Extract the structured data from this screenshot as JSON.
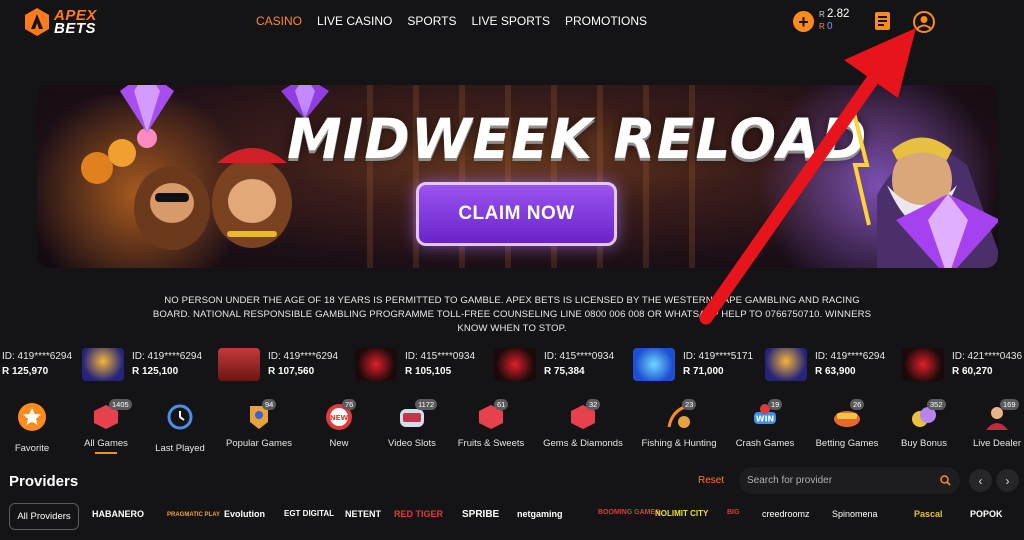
{
  "brand": {
    "line1": "APEX",
    "line2": "BETS"
  },
  "nav": [
    "CASINO",
    "LIVE CASINO",
    "SPORTS",
    "LIVE SPORTS",
    "PROMOTIONS"
  ],
  "balance": {
    "currency": "R",
    "main": "2.82",
    "bonus": "0"
  },
  "banner": {
    "headline": "MIDWEEK RELOAD",
    "cta": "CLAIM NOW"
  },
  "disclaimer": "NO PERSON UNDER THE AGE OF 18 YEARS IS PERMITTED TO GAMBLE. APEX BETS IS LICENSED BY THE WESTERN CAPE GAMBLING AND RACING BOARD. NATIONAL RESPONSIBLE GAMBLING PROGRAMME TOLL-FREE COUNSELING LINE 0800 006 008 OR WHATSAPP HELP TO 0766750710. WINNERS KNOW WHEN TO STOP.",
  "winners": [
    {
      "id": "ID: 419****6294",
      "amount": "R 125,970",
      "game": "jungle"
    },
    {
      "id": "ID: 419****6294",
      "amount": "R 125,100",
      "game": "fruit"
    },
    {
      "id": "ID: 419****6294",
      "amount": "R 107,560",
      "game": "live"
    },
    {
      "id": "ID: 415****0934",
      "amount": "R 105,105",
      "game": "aviator"
    },
    {
      "id": "ID: 415****0934",
      "amount": "R 75,384",
      "game": "aviator"
    },
    {
      "id": "ID: 419****5171",
      "amount": "R 71,000",
      "game": "crash"
    },
    {
      "id": "ID: 419****6294",
      "amount": "R 63,900",
      "game": "fruit"
    },
    {
      "id": "ID: 421****0436",
      "amount": "R 60,270",
      "game": "aviator"
    }
  ],
  "categories": [
    {
      "label": "Favorite",
      "count": ""
    },
    {
      "label": "All Games",
      "count": "1405"
    },
    {
      "label": "Last Played",
      "count": ""
    },
    {
      "label": "Popular Games",
      "count": "94"
    },
    {
      "label": "New",
      "count": "76"
    },
    {
      "label": "Video Slots",
      "count": "1172"
    },
    {
      "label": "Fruits & Sweets",
      "count": "61"
    },
    {
      "label": "Gems & Diamonds",
      "count": "32"
    },
    {
      "label": "Fishing & Hunting",
      "count": "23"
    },
    {
      "label": "Crash Games",
      "count": "19"
    },
    {
      "label": "Betting Games",
      "count": "26"
    },
    {
      "label": "Buy Bonus",
      "count": "352"
    },
    {
      "label": "Live Dealer",
      "count": "169"
    }
  ],
  "providers": {
    "title": "Providers",
    "reset": "Reset",
    "search_placeholder": "Search for provider",
    "all_label": "All Providers",
    "logos": [
      "HABANERO",
      "PRAGMATIC PLAY",
      "Evolution",
      "EGT DIGITAL",
      "NETENT",
      "RED TIGER",
      "SPRIBE",
      "netgaming",
      "BOOMING GAMES",
      "NOLIMIT CITY",
      "BIG",
      "creedroomz",
      "Spinomena",
      "Pascal",
      "POPOK"
    ]
  },
  "colors": {
    "accent": "#ff8a1e",
    "background": "#141416",
    "cta": "#7a35dd",
    "arrow": "#e8141b"
  }
}
